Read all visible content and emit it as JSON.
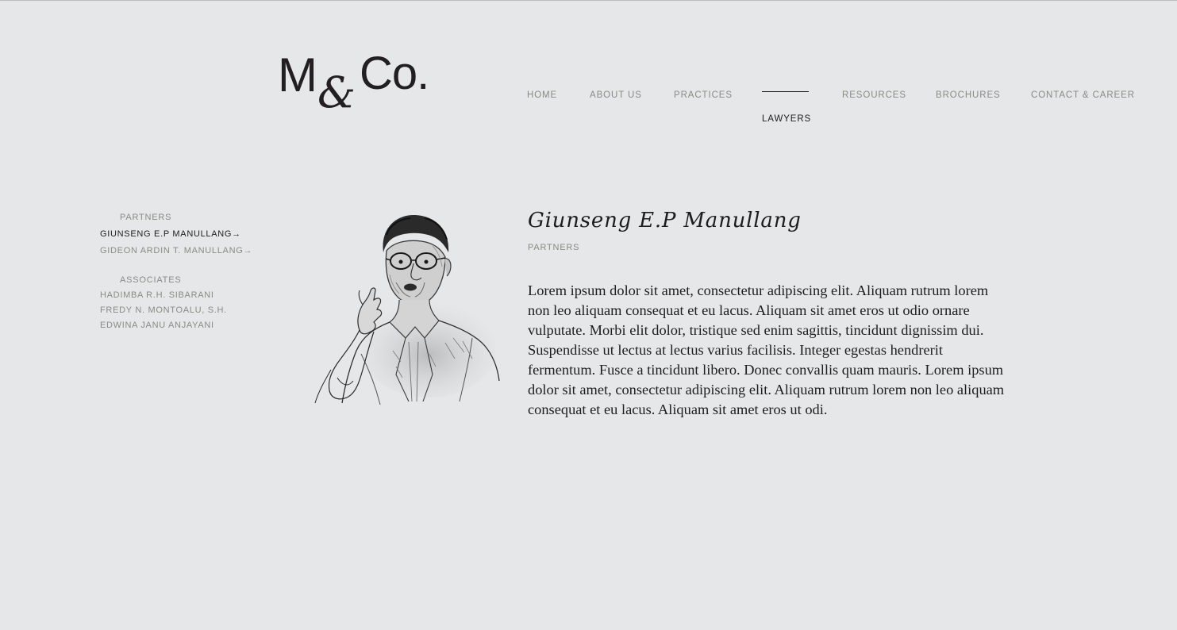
{
  "logo": {
    "m": "M",
    "amp": "&",
    "co": "Co."
  },
  "nav": {
    "items": [
      {
        "label": "HOME"
      },
      {
        "label": "ABOUT US"
      },
      {
        "label": "PRACTICES"
      },
      {
        "label": "RESOURCES"
      },
      {
        "label": "BROCHURES"
      },
      {
        "label": "CONTACT & CAREER"
      }
    ],
    "active": "LAWYERS"
  },
  "sidebar": {
    "partners_heading": "PARTNERS",
    "partners": [
      {
        "label": "GIUNSENG E.P MANULLANG→",
        "active": true
      },
      {
        "label": "GIDEON ARDIN T. MANULLANG→",
        "active": false
      }
    ],
    "associates_heading": "ASSOCIATES",
    "associates": [
      {
        "label": "HADIMBA R.H. SIBARANI"
      },
      {
        "label": "FREDY N. MONTOALU, S.H."
      },
      {
        "label": "EDWINA JANU ANJAYANI"
      }
    ]
  },
  "profile": {
    "name": "Giunseng E.P Manullang",
    "role": "PARTNERS",
    "bio": "Lorem ipsum dolor sit amet, consectetur adipiscing elit. Aliquam rutrum lorem non leo aliquam consequat et eu lacus. Aliquam sit amet eros ut odio ornare vulputate. Morbi elit dolor, tristique sed enim sagittis, tincidunt dignissim dui. Suspendisse ut lectus at lectus varius facilisis. Integer egestas hendrerit fermentum. Fusce a tincidunt libero. Donec convallis quam mauris. Lorem ipsum dolor sit amet, consectetur adipiscing elit. Aliquam rutrum lorem non leo aliquam consequat et eu lacus. Aliquam sit amet eros ut odi."
  },
  "colors": {
    "background": "#e6e7e9",
    "text": "#1d1d1d",
    "muted": "#8a8a84"
  }
}
